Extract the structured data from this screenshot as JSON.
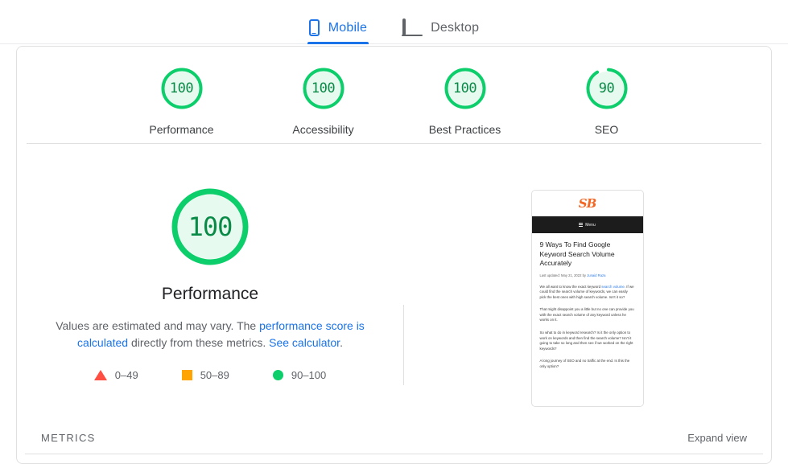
{
  "tabs": [
    {
      "label": "Mobile",
      "icon": "phone-icon",
      "active": true
    },
    {
      "label": "Desktop",
      "icon": "monitor-icon",
      "active": false
    }
  ],
  "colors": {
    "pass": "#0cce6b",
    "pass_text": "#0a8a47",
    "pass_fill": "#e7faf0",
    "average": "#ffa400",
    "fail": "#ff4e42",
    "link": "#1a73e8"
  },
  "category_scores": [
    {
      "label": "Performance",
      "score": 100
    },
    {
      "label": "Accessibility",
      "score": 100
    },
    {
      "label": "Best Practices",
      "score": 100
    },
    {
      "label": "SEO",
      "score": 90
    }
  ],
  "performance": {
    "score": 100,
    "title": "Performance",
    "desc_part1": "Values are estimated and may vary. The ",
    "desc_link1": "performance score is calculated",
    "desc_part2": " directly from these metrics. ",
    "desc_link2": "See calculator",
    "desc_part3": "."
  },
  "legend": [
    {
      "shape": "triangle",
      "label": "0–49"
    },
    {
      "shape": "square",
      "label": "50–89"
    },
    {
      "shape": "circle",
      "label": "90–100"
    }
  ],
  "thumbnail": {
    "logo": "SB",
    "nav_label": "Menu",
    "headline": "9 Ways To Find Google Keyword Search Volume Accurately",
    "byline_prefix": "Last updated: May 21, 2022 by ",
    "byline_author": "Junaid Raza",
    "p1_a": "We all want to know the exact keyword ",
    "p1_link": "search volume",
    "p1_b": ". If we could find the search volume of keywords, we can easily pick the best ones with high search volume. Isn't it so?",
    "p2": "That might disappoint you a little but no one can provide you with the exact search volume of any keyword unless he works on it.",
    "p3": "So what to do in keyword research? Is it the only option to work on keywords and then find the search volume? Isn't it going to take so long and then see if we worked on the right keywords?",
    "p4": "A long journey of SEO and no traffic at the end. Is this the only option?"
  },
  "footer": {
    "metrics_label": "METRICS",
    "expand_label": "Expand view"
  }
}
